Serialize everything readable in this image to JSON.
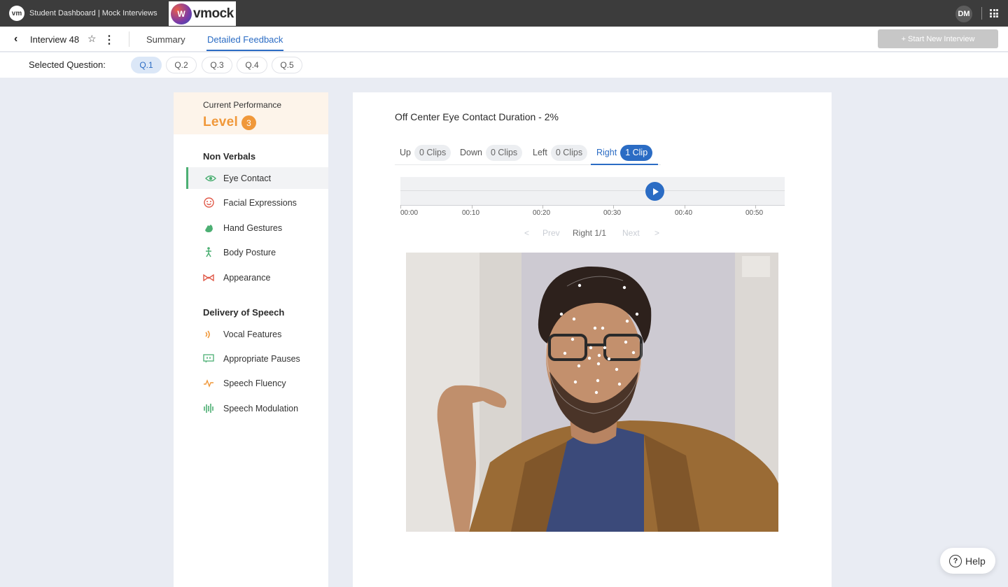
{
  "app": {
    "title": "Student Dashboard | Mock Interviews",
    "brand": "vmock",
    "user_initials": "DM"
  },
  "nav": {
    "interview_name": "Interview 48",
    "tabs": [
      "Summary",
      "Detailed Feedback"
    ],
    "start_button": "+ Start New Interview"
  },
  "questions": {
    "label": "Selected Question:",
    "items": [
      "Q.1",
      "Q.2",
      "Q.3",
      "Q.4",
      "Q.5"
    ],
    "selected": "Q.1"
  },
  "performance": {
    "title": "Current Performance",
    "level_label": "Level",
    "level_value": "3"
  },
  "sections": [
    {
      "heading": "Non Verbals",
      "items": [
        "Eye Contact",
        "Facial Expressions",
        "Hand Gestures",
        "Body Posture",
        "Appearance"
      ]
    },
    {
      "heading": "Delivery of Speech",
      "items": [
        "Vocal Features",
        "Appropriate Pauses",
        "Speech Fluency",
        "Speech Modulation"
      ]
    }
  ],
  "icons": {
    "Eye Contact": "eye-icon",
    "Facial Expressions": "smile-icon",
    "Hand Gestures": "hand-icon",
    "Body Posture": "posture-icon",
    "Appearance": "bowtie-icon",
    "Vocal Features": "sound-wave-icon",
    "Appropriate Pauses": "pause-icon",
    "Speech Fluency": "pulse-icon",
    "Speech Modulation": "equalizer-icon"
  },
  "main": {
    "title": "Off Center Eye Contact Duration - 2%",
    "directions": [
      {
        "name": "Up",
        "count": "0 Clips"
      },
      {
        "name": "Down",
        "count": "0 Clips"
      },
      {
        "name": "Left",
        "count": "0 Clips"
      },
      {
        "name": "Right",
        "count": "1 Clip"
      }
    ],
    "active_direction": "Right",
    "timeline_ticks": [
      "00:00",
      "00:10",
      "00:20",
      "00:30",
      "00:40",
      "00:50"
    ],
    "pager": {
      "prev": "Prev",
      "current": "Right 1/1",
      "next": "Next",
      "prev_arrow": "<",
      "next_arrow": ">"
    }
  },
  "help": {
    "label": "Help",
    "icon_text": "?"
  },
  "colors": {
    "accent": "#2b6cc4",
    "level": "#f0983a",
    "active_bar": "#4caf73",
    "topbar": "#3c3c3c"
  }
}
